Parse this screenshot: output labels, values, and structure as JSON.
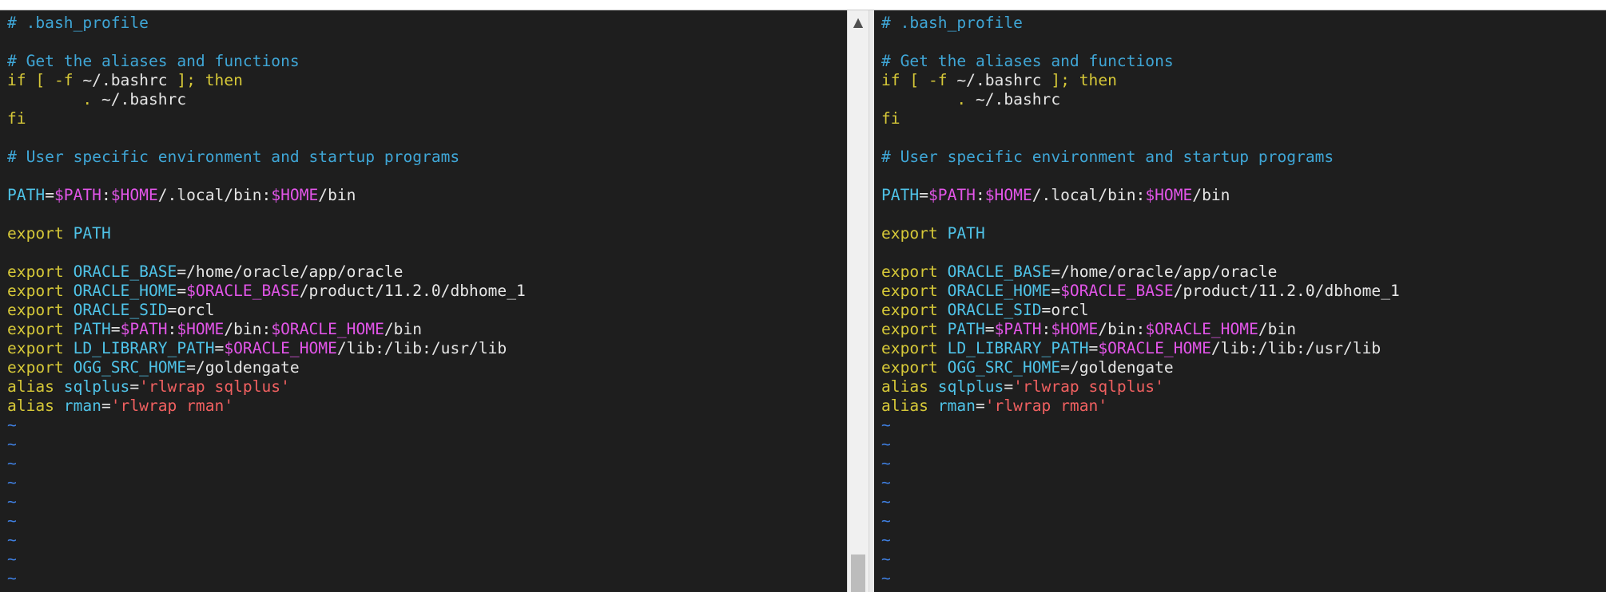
{
  "editor": {
    "lines": [
      [
        {
          "c": "comment",
          "t": "# .bash_profile"
        }
      ],
      [],
      [
        {
          "c": "comment",
          "t": "# Get the aliases and functions"
        }
      ],
      [
        {
          "c": "keyword",
          "t": "if [ -f "
        },
        {
          "c": "text",
          "t": "~/.bashrc"
        },
        {
          "c": "keyword",
          "t": " ]; then"
        }
      ],
      [
        {
          "c": "text",
          "t": "        "
        },
        {
          "c": "keyword",
          "t": ". "
        },
        {
          "c": "text",
          "t": "~/.bashrc"
        }
      ],
      [
        {
          "c": "keyword",
          "t": "fi"
        }
      ],
      [],
      [
        {
          "c": "comment",
          "t": "# User specific environment and startup programs"
        }
      ],
      [],
      [
        {
          "c": "ident",
          "t": "PATH"
        },
        {
          "c": "text",
          "t": "="
        },
        {
          "c": "var",
          "t": "$PATH"
        },
        {
          "c": "text",
          "t": ":"
        },
        {
          "c": "var",
          "t": "$HOME"
        },
        {
          "c": "text",
          "t": "/.local/bin:"
        },
        {
          "c": "var",
          "t": "$HOME"
        },
        {
          "c": "text",
          "t": "/bin"
        }
      ],
      [],
      [
        {
          "c": "keyword",
          "t": "export "
        },
        {
          "c": "ident",
          "t": "PATH"
        }
      ],
      [],
      [
        {
          "c": "keyword",
          "t": "export "
        },
        {
          "c": "ident",
          "t": "ORACLE_BASE"
        },
        {
          "c": "text",
          "t": "=/home/oracle/app/oracle"
        }
      ],
      [
        {
          "c": "keyword",
          "t": "export "
        },
        {
          "c": "ident",
          "t": "ORACLE_HOME"
        },
        {
          "c": "text",
          "t": "="
        },
        {
          "c": "var",
          "t": "$ORACLE_BASE"
        },
        {
          "c": "text",
          "t": "/product/11.2.0/dbhome_1"
        }
      ],
      [
        {
          "c": "keyword",
          "t": "export "
        },
        {
          "c": "ident",
          "t": "ORACLE_SID"
        },
        {
          "c": "text",
          "t": "=orcl"
        }
      ],
      [
        {
          "c": "keyword",
          "t": "export "
        },
        {
          "c": "ident",
          "t": "PATH"
        },
        {
          "c": "text",
          "t": "="
        },
        {
          "c": "var",
          "t": "$PATH"
        },
        {
          "c": "text",
          "t": ":"
        },
        {
          "c": "var",
          "t": "$HOME"
        },
        {
          "c": "text",
          "t": "/bin:"
        },
        {
          "c": "var",
          "t": "$ORACLE_HOME"
        },
        {
          "c": "text",
          "t": "/bin"
        }
      ],
      [
        {
          "c": "keyword",
          "t": "export "
        },
        {
          "c": "ident",
          "t": "LD_LIBRARY_PATH"
        },
        {
          "c": "text",
          "t": "="
        },
        {
          "c": "var",
          "t": "$ORACLE_HOME"
        },
        {
          "c": "text",
          "t": "/lib:/lib:/usr/lib"
        }
      ],
      [
        {
          "c": "keyword",
          "t": "export "
        },
        {
          "c": "ident",
          "t": "OGG_SRC_HOME"
        },
        {
          "c": "text",
          "t": "=/goldengate"
        }
      ],
      [
        {
          "c": "keyword",
          "t": "alias "
        },
        {
          "c": "ident",
          "t": "sqlplus"
        },
        {
          "c": "text",
          "t": "="
        },
        {
          "c": "string",
          "t": "'rlwrap sqlplus'"
        }
      ],
      [
        {
          "c": "keyword",
          "t": "alias "
        },
        {
          "c": "ident",
          "t": "rman"
        },
        {
          "c": "text",
          "t": "="
        },
        {
          "c": "string",
          "t": "'rlwrap rman'"
        }
      ],
      [
        {
          "c": "tilde",
          "t": "~"
        }
      ],
      [
        {
          "c": "tilde",
          "t": "~"
        }
      ],
      [
        {
          "c": "tilde",
          "t": "~"
        }
      ],
      [
        {
          "c": "tilde",
          "t": "~"
        }
      ],
      [
        {
          "c": "tilde",
          "t": "~"
        }
      ],
      [
        {
          "c": "tilde",
          "t": "~"
        }
      ],
      [
        {
          "c": "tilde",
          "t": "~"
        }
      ],
      [
        {
          "c": "tilde",
          "t": "~"
        }
      ],
      [
        {
          "c": "tilde",
          "t": "~"
        }
      ]
    ]
  },
  "scrollbar": {
    "up_arrow_icon": "▲"
  },
  "colors": {
    "background": "#1e1e1e",
    "comment": "#3fa6d6",
    "keyword": "#d6c838",
    "variable": "#e255e8",
    "identifier": "#4fc3e8",
    "text": "#e6e6e6",
    "string": "#f06060",
    "tilde": "#3f7fe0"
  }
}
